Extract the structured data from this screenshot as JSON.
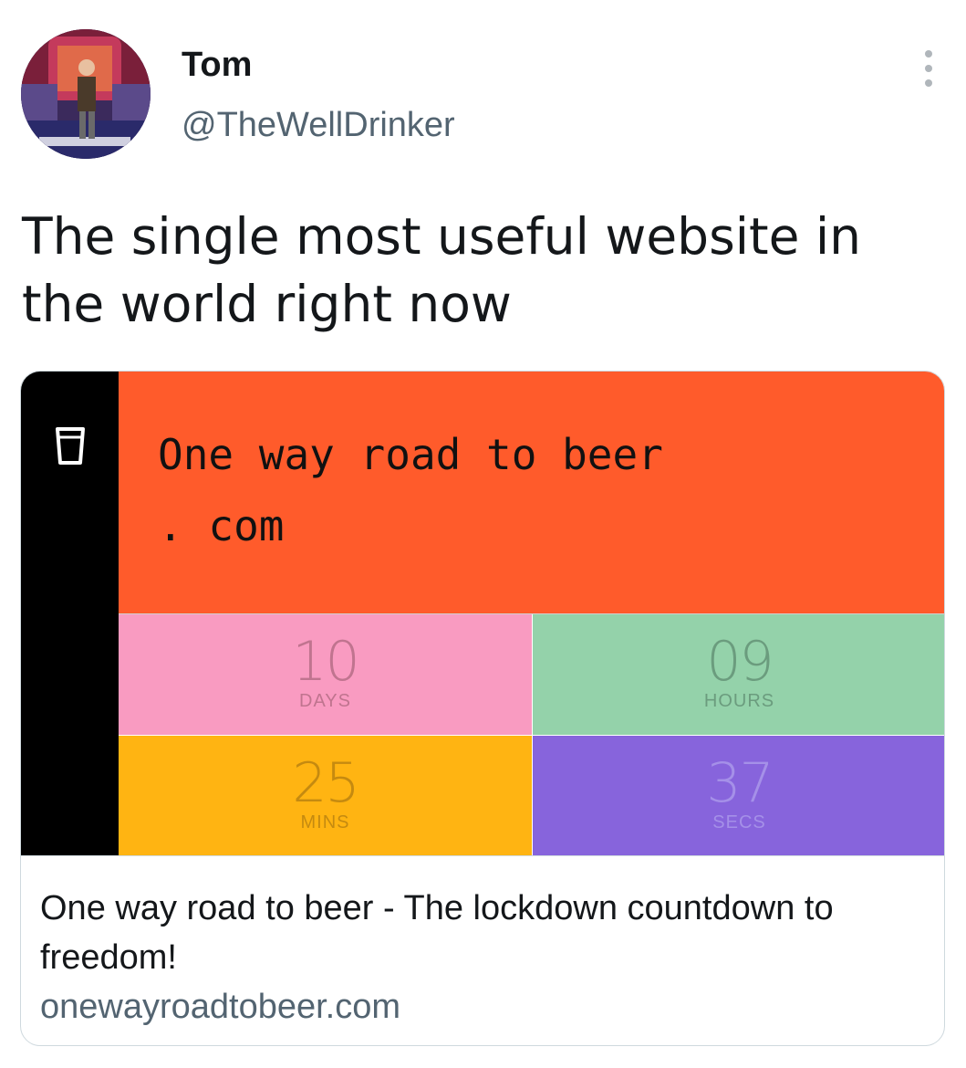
{
  "author": {
    "name": "Tom",
    "handle": "@TheWellDrinker"
  },
  "tweet": {
    "text": "The single most useful website in the world right now"
  },
  "card": {
    "hero_title": "One way road to beer\n. com",
    "countdown": [
      {
        "value": "10",
        "unit": "DAYS"
      },
      {
        "value": "09",
        "unit": "HOURS"
      },
      {
        "value": "25",
        "unit": "MINS"
      },
      {
        "value": "37",
        "unit": "SECS"
      }
    ],
    "title": "One way road to beer - The lockdown countdown to freedom!",
    "domain": "onewayroadtobeer.com"
  },
  "colors": {
    "hero": "#ff5b2b",
    "days": "#f99bc1",
    "hours": "#94d2aa",
    "mins": "#ffb412",
    "secs": "#8764dc"
  },
  "icons": [
    "beer-glass-icon",
    "more-options-icon"
  ]
}
